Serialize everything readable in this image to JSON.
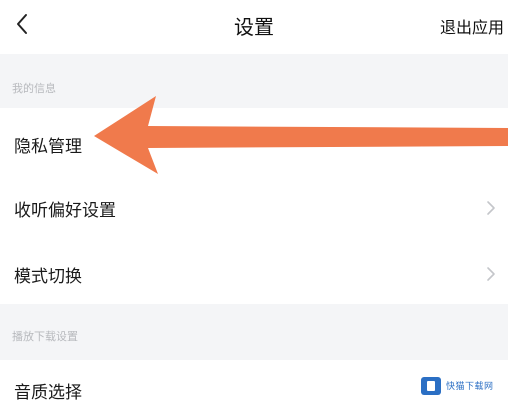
{
  "header": {
    "back_icon": "chevron-left-icon",
    "title": "设置",
    "exit_label": "退出应用"
  },
  "sections": [
    {
      "title": "我的信息",
      "items": [
        {
          "label": "隐私管理",
          "chevron": false
        },
        {
          "label": "收听偏好设置",
          "chevron": true,
          "chevron_icon": "chevron-right-icon"
        },
        {
          "label": "模式切换",
          "chevron": true,
          "chevron_icon": "chevron-right-icon"
        }
      ]
    },
    {
      "title": "播放下载设置",
      "items": [
        {
          "label": "音质选择",
          "chevron": false
        }
      ]
    }
  ],
  "annotation": {
    "icon": "arrow-left-icon",
    "color": "#f07a4c"
  },
  "watermark": {
    "logo_icon": "kuaiyong-logo-icon",
    "text": "快猫下载网"
  },
  "colors": {
    "background": "#f4f5f7",
    "surface": "#ffffff",
    "section_text": "#b7b9bd",
    "arrow": "#f07a4c"
  }
}
